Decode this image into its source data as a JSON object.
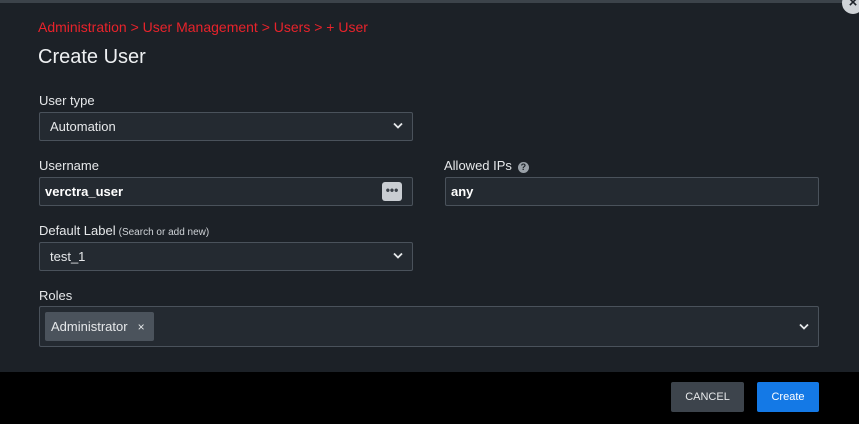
{
  "breadcrumb": "Administration > User Management > Users > + User",
  "title": "Create User",
  "close_icon": "close-icon",
  "user_type": {
    "label": "User type",
    "value": "Automation"
  },
  "username": {
    "label": "Username",
    "value": "verctra_user",
    "icon": "password-dots-icon"
  },
  "allowed_ips": {
    "label": "Allowed IPs",
    "value": "any",
    "help_icon": "?"
  },
  "default_label": {
    "label": "Default Label",
    "hint": "(Search or add new)",
    "value": "test_1"
  },
  "roles": {
    "label": "Roles",
    "chips": [
      {
        "label": "Administrator",
        "remove": "×"
      }
    ]
  },
  "footer": {
    "cancel_label": "CANCEL",
    "create_label": "Create"
  },
  "colors": {
    "accent": "#1479e6",
    "breadcrumb": "#e8232b",
    "background": "#1c2127",
    "footer": "#000000"
  }
}
